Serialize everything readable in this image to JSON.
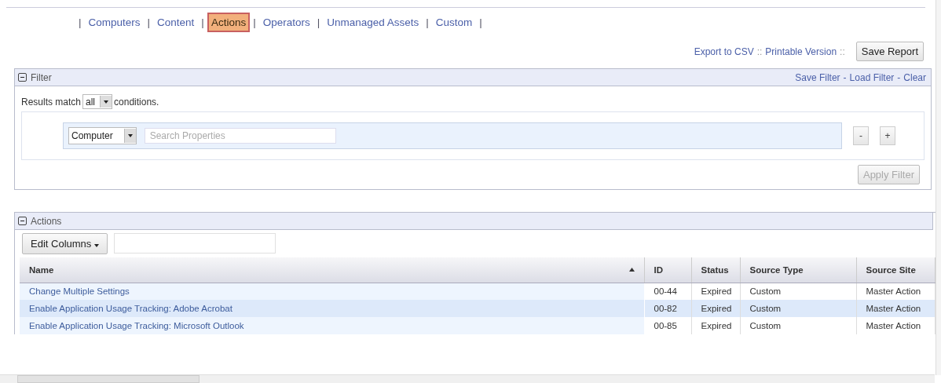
{
  "nav_separator": "|",
  "nav_tabs": [
    {
      "label": "Computers",
      "selected": false
    },
    {
      "label": "Content",
      "selected": false
    },
    {
      "label": "Actions",
      "selected": true
    },
    {
      "label": "Operators",
      "selected": false
    },
    {
      "label": "Unmanaged Assets",
      "selected": false
    },
    {
      "label": "Custom",
      "selected": false
    }
  ],
  "report_links": [
    "Export to CSV",
    "Printable Version"
  ],
  "report_separator": "::",
  "save_report_button": "Save Report",
  "filter_panel": {
    "title": "Filter",
    "expanded": true,
    "links": [
      "Save Filter",
      "Load Filter",
      "Clear"
    ],
    "link_separator": "-",
    "match_prefix": "Results match",
    "match_value": "all",
    "match_suffix": "conditions.",
    "property_type": "Computer",
    "search": {
      "placeholder": "Search Properties"
    },
    "remove_button": "-",
    "add_button": "+",
    "apply_button": {
      "label": "Apply Filter",
      "disabled": true
    }
  },
  "actions_panel": {
    "title": "Actions",
    "expanded": true,
    "edit_columns_button": "Edit Columns",
    "table": {
      "columns": [
        {
          "label": "Name",
          "sorted": true
        },
        {
          "label": "ID",
          "sorted": false
        },
        {
          "label": "Status",
          "sorted": false
        },
        {
          "label": "Source Type",
          "sorted": false
        },
        {
          "label": "Source Site",
          "sorted": false
        }
      ],
      "rows": [
        {
          "cells": [
            "Change Multiple Settings",
            "00-44",
            "Expired",
            "Custom",
            "Master Action"
          ],
          "selected": false
        },
        {
          "cells": [
            "Enable Application Usage Tracking: Adobe Acrobat",
            "00-82",
            "Expired",
            "Custom",
            "Master Action"
          ],
          "selected": true
        },
        {
          "cells": [
            "Enable Application Usage Tracking: Microsoft Outlook",
            "00-85",
            "Expired",
            "Custom",
            "Master Action"
          ],
          "selected": false
        }
      ]
    }
  }
}
